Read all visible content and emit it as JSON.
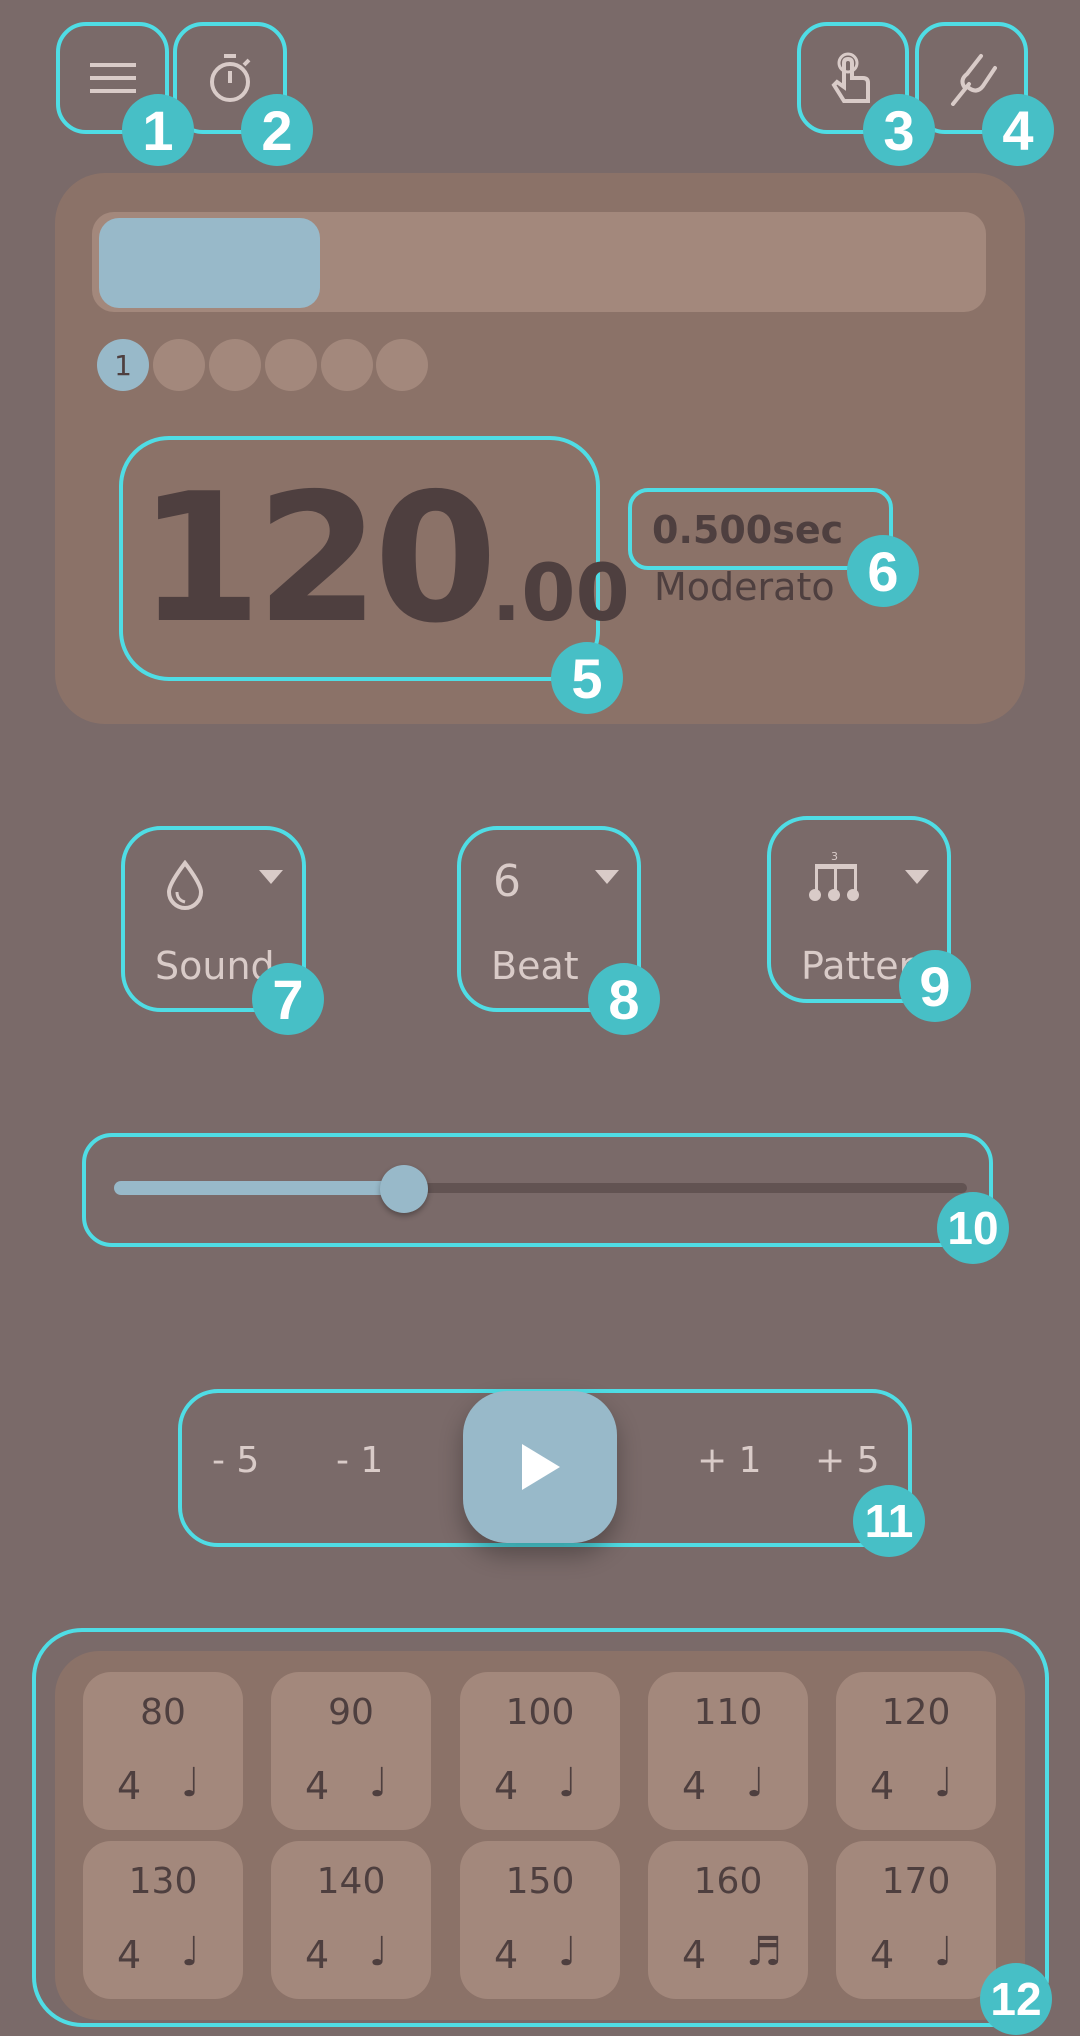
{
  "toolbar": {
    "menu_icon": "hamburger-icon",
    "timer_icon": "stopwatch-icon",
    "tap_icon": "tap-finger-icon",
    "tuner_icon": "tuning-fork-icon"
  },
  "progress": {
    "value_percent": 19,
    "beats": [
      "1",
      "",
      "",
      "",
      "",
      ""
    ],
    "current_beat": 1
  },
  "tempo": {
    "bpm_int": "120",
    "bpm_dec": ".00",
    "interval": "0.500sec",
    "marking": "Moderato"
  },
  "selectors": {
    "sound": {
      "icon": "droplet-icon",
      "label": "Sound"
    },
    "beat": {
      "value": "6",
      "label": "Beat"
    },
    "pattern": {
      "icon": "triplet-notes-icon",
      "label": "Pattern"
    }
  },
  "slider": {
    "fraction": 0.34
  },
  "controls": {
    "minus5": "- 5",
    "minus1": "- 1",
    "plus1": "+ 1",
    "plus5": "+ 5",
    "play_icon": "play-icon"
  },
  "presets": [
    {
      "bpm": "80",
      "beat": "4",
      "note": "♩"
    },
    {
      "bpm": "90",
      "beat": "4",
      "note": "♩"
    },
    {
      "bpm": "100",
      "beat": "4",
      "note": "♩"
    },
    {
      "bpm": "110",
      "beat": "4",
      "note": "♩"
    },
    {
      "bpm": "120",
      "beat": "4",
      "note": "♩"
    },
    {
      "bpm": "130",
      "beat": "4",
      "note": "♩"
    },
    {
      "bpm": "140",
      "beat": "4",
      "note": "♩"
    },
    {
      "bpm": "150",
      "beat": "4",
      "note": "♩"
    },
    {
      "bpm": "160",
      "beat": "4",
      "note": "♬"
    },
    {
      "bpm": "170",
      "beat": "4",
      "note": "♩"
    }
  ],
  "badges": [
    "1",
    "2",
    "3",
    "4",
    "5",
    "6",
    "7",
    "8",
    "9",
    "10",
    "11",
    "12"
  ],
  "colors": {
    "background": "#7a6a69",
    "card": "#8b7268",
    "accent": "#98b9c9",
    "highlight": "#4fdde5",
    "badge": "#47bfc6"
  }
}
